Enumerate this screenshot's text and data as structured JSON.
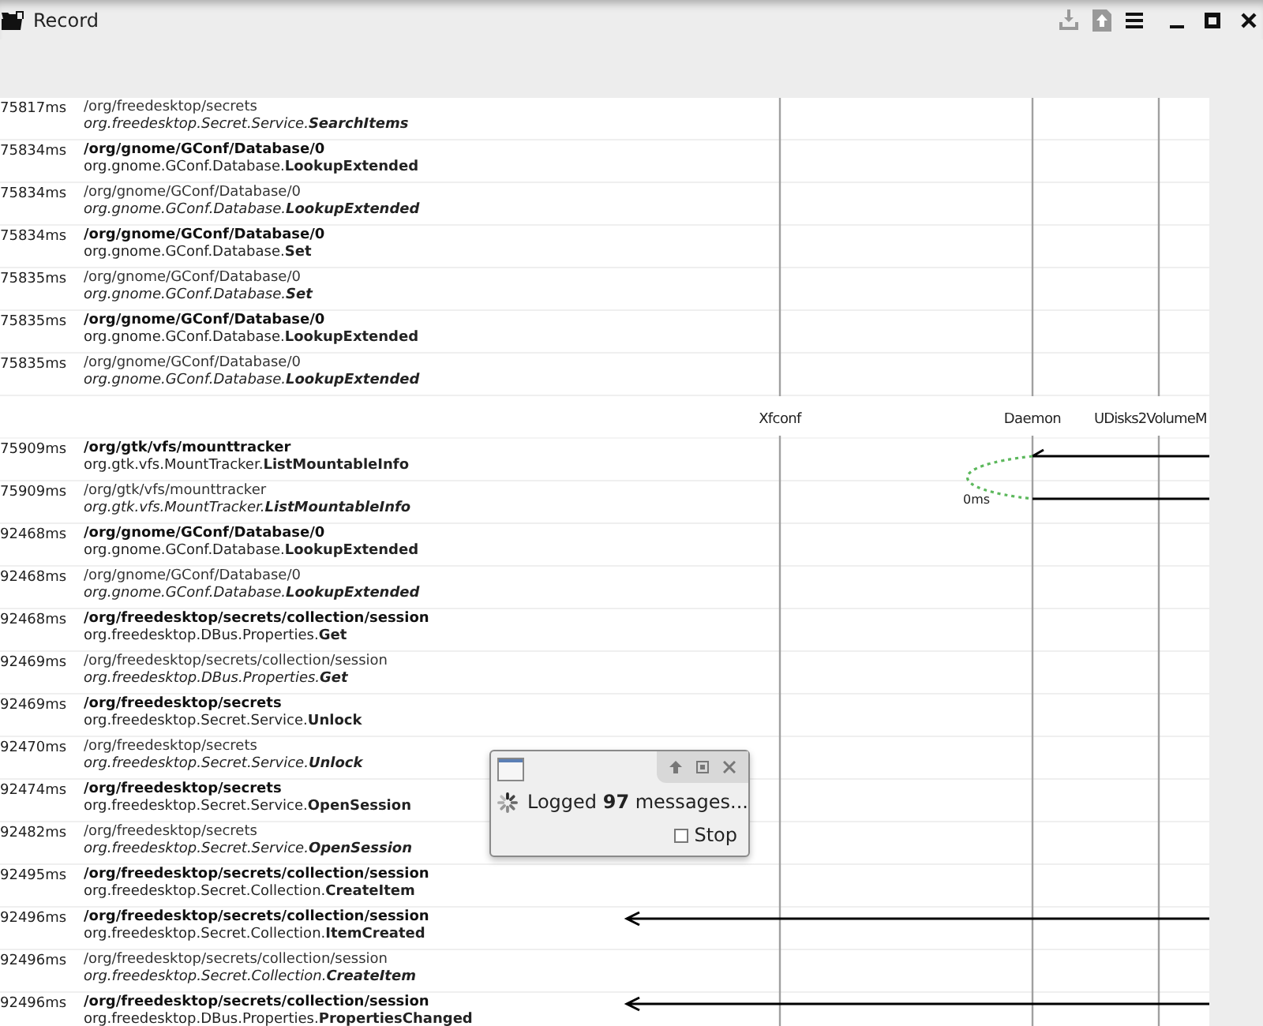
{
  "window": {
    "title": "Record"
  },
  "messages": [
    {
      "kind": "return",
      "time": "75817ms",
      "path": "/org/freedesktop/secrets",
      "interface": "org.freedesktop.Secret.Service.",
      "member": "SearchItems"
    },
    {
      "kind": "call",
      "time": "75834ms",
      "path": "/org/gnome/GConf/Database/0",
      "interface": "org.gnome.GConf.Database.",
      "member": "LookupExtended"
    },
    {
      "kind": "return",
      "time": "75834ms",
      "path": "/org/gnome/GConf/Database/0",
      "interface": "org.gnome.GConf.Database.",
      "member": "LookupExtended"
    },
    {
      "kind": "call",
      "time": "75834ms",
      "path": "/org/gnome/GConf/Database/0",
      "interface": "org.gnome.GConf.Database.",
      "member": "Set"
    },
    {
      "kind": "return",
      "time": "75835ms",
      "path": "/org/gnome/GConf/Database/0",
      "interface": "org.gnome.GConf.Database.",
      "member": "Set"
    },
    {
      "kind": "call",
      "time": "75835ms",
      "path": "/org/gnome/GConf/Database/0",
      "interface": "org.gnome.GConf.Database.",
      "member": "LookupExtended"
    },
    {
      "kind": "return",
      "time": "75835ms",
      "path": "/org/gnome/GConf/Database/0",
      "interface": "org.gnome.GConf.Database.",
      "member": "LookupExtended"
    },
    {
      "kind": "lane_header",
      "lanes": [
        {
          "name": "Xfconf"
        },
        {
          "name": "Daemon"
        },
        {
          "name": "UDisks2VolumeM"
        }
      ]
    },
    {
      "kind": "call",
      "time": "75909ms",
      "path": "/org/gtk/vfs/mounttracker",
      "interface": "org.gtk.vfs.MountTracker.",
      "member": "ListMountableInfo",
      "arrow": {
        "kind": "incoming"
      }
    },
    {
      "kind": "return",
      "time": "75909ms",
      "path": "/org/gtk/vfs/mounttracker",
      "interface": "org.gtk.vfs.MountTracker.",
      "member": "ListMountableInfo",
      "arrow": {
        "kind": "reply",
        "duration": "0ms"
      }
    },
    {
      "kind": "call",
      "time": "92468ms",
      "path": "/org/gnome/GConf/Database/0",
      "interface": "org.gnome.GConf.Database.",
      "member": "LookupExtended"
    },
    {
      "kind": "return",
      "time": "92468ms",
      "path": "/org/gnome/GConf/Database/0",
      "interface": "org.gnome.GConf.Database.",
      "member": "LookupExtended"
    },
    {
      "kind": "call",
      "time": "92468ms",
      "path": "/org/freedesktop/secrets/collection/session",
      "interface": "org.freedesktop.DBus.Properties.",
      "member": "Get"
    },
    {
      "kind": "return",
      "time": "92469ms",
      "path": "/org/freedesktop/secrets/collection/session",
      "interface": "org.freedesktop.DBus.Properties.",
      "member": "Get"
    },
    {
      "kind": "call",
      "time": "92469ms",
      "path": "/org/freedesktop/secrets",
      "interface": "org.freedesktop.Secret.Service.",
      "member": "Unlock"
    },
    {
      "kind": "return",
      "time": "92470ms",
      "path": "/org/freedesktop/secrets",
      "interface": "org.freedesktop.Secret.Service.",
      "member": "Unlock"
    },
    {
      "kind": "call",
      "time": "92474ms",
      "path": "/org/freedesktop/secrets",
      "interface": "org.freedesktop.Secret.Service.",
      "member": "OpenSession"
    },
    {
      "kind": "return",
      "time": "92482ms",
      "path": "/org/freedesktop/secrets",
      "interface": "org.freedesktop.Secret.Service.",
      "member": "OpenSession"
    },
    {
      "kind": "call",
      "time": "92495ms",
      "path": "/org/freedesktop/secrets/collection/session",
      "interface": "org.freedesktop.Secret.Collection.",
      "member": "CreateItem"
    },
    {
      "kind": "call",
      "time": "92496ms",
      "path": "/org/freedesktop/secrets/collection/session",
      "interface": "org.freedesktop.Secret.Collection.",
      "member": "ItemCreated",
      "arrow": {
        "kind": "broadcast"
      }
    },
    {
      "kind": "return",
      "time": "92496ms",
      "path": "/org/freedesktop/secrets/collection/session",
      "interface": "org.freedesktop.Secret.Collection.",
      "member": "CreateItem"
    },
    {
      "kind": "call",
      "time": "92496ms",
      "path": "/org/freedesktop/secrets/collection/session",
      "interface": "org.freedesktop.DBus.Properties.",
      "member": "PropertiesChanged",
      "arrow": {
        "kind": "broadcast"
      }
    }
  ],
  "dialog": {
    "message": "Logged **97** messages...",
    "stop": {
      "label": "Stop",
      "checked": false
    }
  }
}
